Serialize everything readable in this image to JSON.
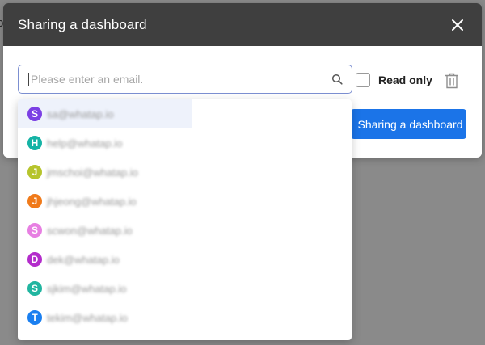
{
  "backdrop": {
    "edge_char": "p"
  },
  "dialog": {
    "title": "Sharing a dashboard",
    "close_icon": "close-icon",
    "email_input": {
      "placeholder": "Please enter an email.",
      "value": ""
    },
    "search_icon": "search-icon",
    "read_only_label": "Read only",
    "read_only_checked": false,
    "trash_icon": "trash-icon",
    "share_button_label": "Sharing a dashboard",
    "colors": {
      "header_bg": "#3f3f3f",
      "accent": "#1b74e8",
      "input_border": "#7c8fd1"
    }
  },
  "suggestions": [
    {
      "initial": "S",
      "email": "sa@whatap.io",
      "color": "#7b3fe4",
      "highlighted": true
    },
    {
      "initial": "H",
      "email": "help@whatap.io",
      "color": "#15b3a5",
      "highlighted": false
    },
    {
      "initial": "J",
      "email": "jmschoi@whatap.io",
      "color": "#b6c42c",
      "highlighted": false
    },
    {
      "initial": "J",
      "email": "jhjeong@whatap.io",
      "color": "#f07a1a",
      "highlighted": false
    },
    {
      "initial": "S",
      "email": "scwon@whatap.io",
      "color": "#e77fe2",
      "highlighted": false
    },
    {
      "initial": "D",
      "email": "dek@whatap.io",
      "color": "#b32ccb",
      "highlighted": false
    },
    {
      "initial": "S",
      "email": "sjkim@whatap.io",
      "color": "#21b5a0",
      "highlighted": false
    },
    {
      "initial": "T",
      "email": "tekim@whatap.io",
      "color": "#1a7ff0",
      "highlighted": false
    }
  ]
}
